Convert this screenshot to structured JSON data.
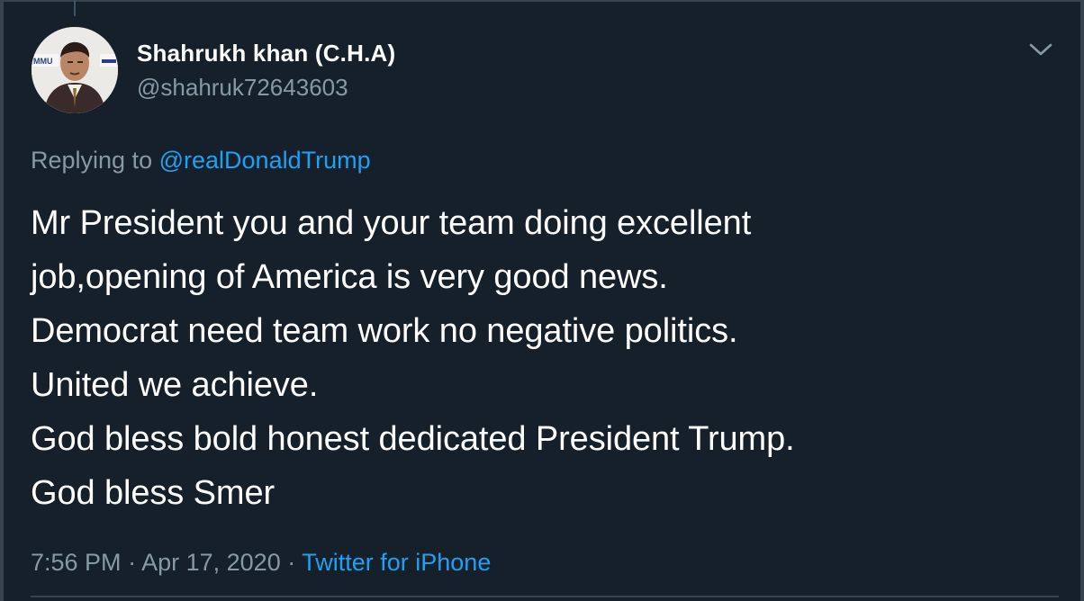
{
  "tweet": {
    "author": {
      "display_name": "Shahrukh khan (C.H.A)",
      "handle": "@shahruk72643603",
      "avatar_icon": "profile-photo"
    },
    "more_icon": "chevron-down-icon",
    "reply": {
      "prefix": "Replying to",
      "mention": "@realDonaldTrump"
    },
    "text_lines": [
      "Mr President you and your team doing excellent",
      "job,opening of America is very good news.",
      "Democrat need team work no negative politics.",
      "United we achieve.",
      "God bless bold honest dedicated President Trump.",
      "God bless Smer"
    ],
    "meta": {
      "time": "7:56 PM",
      "separator_1": "·",
      "date": "Apr 17, 2020",
      "separator_2": "·",
      "source": "Twitter for iPhone"
    }
  },
  "colors": {
    "background": "#15202b",
    "text": "#ffffff",
    "secondary_text": "#8899a6",
    "link": "#1da1f2",
    "border": "#38444d"
  }
}
